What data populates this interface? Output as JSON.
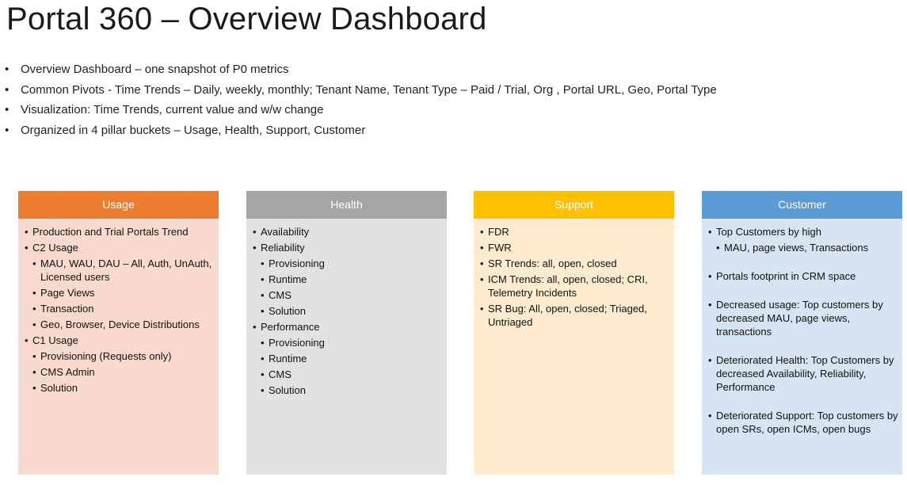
{
  "title": "Portal 360 – Overview Dashboard",
  "bullets": [
    "Overview Dashboard – one snapshot of P0 metrics",
    "Common Pivots - Time Trends – Daily, weekly, monthly; Tenant Name, Tenant Type – Paid / Trial, Org , Portal URL, Geo, Portal Type",
    "Visualization: Time Trends, current value and w/w change",
    "Organized in 4 pillar buckets – Usage, Health, Support, Customer"
  ],
  "colors": {
    "usage_header": "#ed7d31",
    "usage_body": "#fad9ce",
    "health_header": "#a5a5a5",
    "health_body": "#e2e2e2",
    "support_header": "#ffc000",
    "support_body": "#ffeccf",
    "customer_header": "#5b9bd5",
    "customer_body": "#d6e4f3"
  },
  "pillars": {
    "usage": {
      "header": "Usage",
      "items": [
        "Production and Trial Portals Trend",
        "C2 Usage",
        "MAU, WAU, DAU – All, Auth, UnAuth, Licensed users",
        "Page Views",
        "Transaction",
        "Geo, Browser, Device Distributions",
        "C1 Usage",
        "Provisioning (Requests only)",
        "CMS Admin",
        "Solution"
      ]
    },
    "health": {
      "header": "Health",
      "items": [
        "Availability",
        "Reliability",
        "Provisioning",
        "Runtime",
        "CMS",
        "Solution",
        "Performance",
        "Provisioning",
        "Runtime",
        "CMS",
        "Solution"
      ]
    },
    "support": {
      "header": "Support",
      "items": [
        "FDR",
        "FWR",
        "SR Trends: all, open, closed",
        "ICM Trends: all, open, closed; CRI, Telemetry Incidents",
        "SR Bug: All, open, closed; Triaged, Untriaged"
      ]
    },
    "customer": {
      "header": "Customer",
      "items": [
        "Top Customers by high",
        "MAU, page views,  Transactions",
        "Portals footprint in CRM space",
        "Decreased usage: Top customers by decreased MAU, page views, transactions",
        "Deteriorated Health: Top Customers by decreased Availability, Reliability, Performance",
        "Deteriorated Support:  Top customers by open SRs, open ICMs, open bugs"
      ]
    }
  }
}
